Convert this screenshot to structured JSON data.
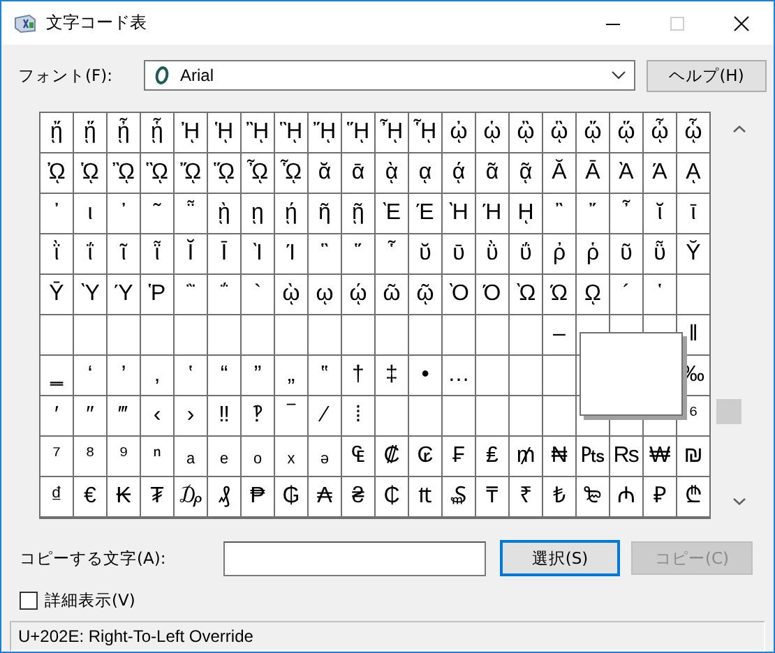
{
  "window": {
    "title": "文字コード表",
    "maximize_enabled": false
  },
  "font": {
    "label": "フォント(F):",
    "value": "Arial",
    "help_button": "ヘルプ(H)"
  },
  "grid": {
    "rows": [
      [
        "ᾔ",
        "ᾕ",
        "ᾖ",
        "ᾗ",
        "ᾘ",
        "ᾙ",
        "ᾚ",
        "ᾛ",
        "ᾜ",
        "ᾝ",
        "ᾞ",
        "ᾟ",
        "ᾠ",
        "ᾡ",
        "ᾢ",
        "ᾣ",
        "ᾤ",
        "ᾥ",
        "ᾦ",
        "ᾧ"
      ],
      [
        "ᾨ",
        "ᾩ",
        "ᾪ",
        "ᾫ",
        "ᾬ",
        "ᾭ",
        "ᾮ",
        "ᾯ",
        "ᾰ",
        "ᾱ",
        "ᾲ",
        "ᾳ",
        "ᾴ",
        "ᾶ",
        "ᾷ",
        "Ᾰ",
        "Ᾱ",
        "Ὰ",
        "Ά",
        "ᾼ"
      ],
      [
        "᾽",
        "ι",
        "᾿",
        "῀",
        "῁",
        "ῂ",
        "ῃ",
        "ῄ",
        "ῆ",
        "ῇ",
        "Ὲ",
        "Έ",
        "Ὴ",
        "Ή",
        "ῌ",
        "῍",
        "῎",
        "῏",
        "ῐ",
        "ῑ"
      ],
      [
        "ῒ",
        "ΐ",
        "ῖ",
        "ῗ",
        "Ῐ",
        "Ῑ",
        "Ὶ",
        "Ί",
        "῝",
        "῞",
        "῟",
        "ῠ",
        "ῡ",
        "ῢ",
        "ΰ",
        "ῤ",
        "ῥ",
        "ῦ",
        "ῧ",
        "Ῠ"
      ],
      [
        "Ῡ",
        "Ὺ",
        "Ύ",
        "Ῥ",
        "῭",
        "΅",
        "`",
        "ῲ",
        "ῳ",
        "ῴ",
        "ῶ",
        "ῷ",
        "Ὸ",
        "Ό",
        "Ὼ",
        "Ώ",
        "ῼ",
        "´",
        "῾",
        null
      ],
      [
        null,
        null,
        null,
        null,
        null,
        null,
        null,
        null,
        null,
        null,
        null,
        null,
        null,
        null,
        null,
        "–",
        null,
        null,
        null,
        "‖"
      ],
      [
        "‗",
        "‘",
        "’",
        "‚",
        "‛",
        "“",
        "”",
        "„",
        "‟",
        "†",
        "‡",
        "•",
        "…",
        null,
        null,
        null,
        null,
        null,
        null,
        "‰"
      ],
      [
        "′",
        "″",
        "‴",
        "‹",
        "›",
        "‼",
        "‽",
        "‾",
        "⁄",
        "⁞",
        null,
        null,
        null,
        null,
        null,
        null,
        null,
        null,
        null,
        "⁶"
      ],
      [
        "⁷",
        "⁸",
        "⁹",
        "ⁿ",
        "ₐ",
        "ₑ",
        "ₒ",
        "ₓ",
        "ₔ",
        "₠",
        "₡",
        "₢",
        "₣",
        "₤",
        "₥",
        "₦",
        "₧",
        "₨",
        "₩",
        "₪"
      ],
      [
        "₫",
        "€",
        "₭",
        "₮",
        "₯",
        "₰",
        "₱",
        "₲",
        "₳",
        "₴",
        "₵",
        "₶",
        "₷",
        "₸",
        "₹",
        "₺",
        "₻",
        "₼",
        "₽",
        "₾"
      ]
    ],
    "magnifier_shown": true
  },
  "copy": {
    "label": "コピーする文字(A):",
    "select_button": "選択(S)",
    "select_default": true,
    "copy_button": "コピー(C)",
    "copy_disabled": true
  },
  "details": {
    "label": "詳細表示(V)",
    "checked": false
  },
  "status_bar": "U+202E: Right-To-Left Override"
}
